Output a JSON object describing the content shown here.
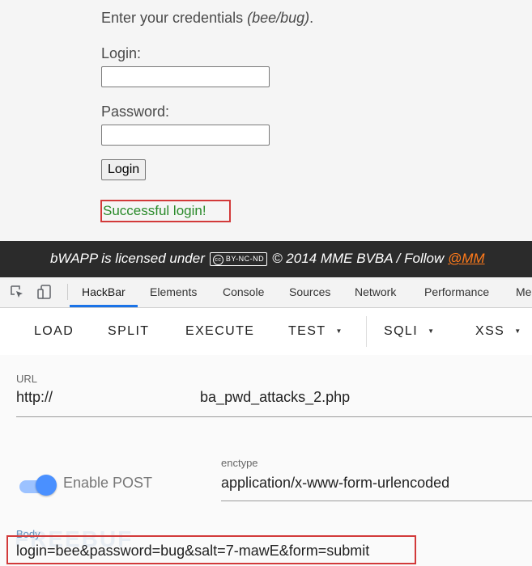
{
  "login_page": {
    "intro_text": "Enter your credentials ",
    "intro_hint": "(bee/bug)",
    "intro_end": ".",
    "login_label": "Login:",
    "password_label": "Password:",
    "login_button": "Login",
    "success_message": "Successful login!"
  },
  "license": {
    "prefix": "bWAPP is licensed under",
    "cc_text": "BY-NC-ND",
    "copyright": "© 2014 MME BVBA / Follow",
    "follow_link": "@MM"
  },
  "devtools": {
    "tabs": [
      "HackBar",
      "Elements",
      "Console",
      "Sources",
      "Network",
      "Performance",
      "Me"
    ],
    "active_tab": "HackBar"
  },
  "hackbar": {
    "buttons": {
      "load": "LOAD",
      "split": "SPLIT",
      "execute": "EXECUTE",
      "test": "TEST",
      "sqli": "SQLI",
      "xss": "XSS"
    },
    "url_label": "URL",
    "url_value": "http://",
    "url_suffix": "ba_pwd_attacks_2.php",
    "enable_post_label": "Enable POST",
    "enable_post_on": true,
    "enctype_label": "enctype",
    "enctype_value": "application/x-www-form-urlencoded",
    "body_label": "Body",
    "body_value": "login=bee&password=bug&salt=7-mawE&form=submit"
  },
  "colors": {
    "accent": "#1a73e8",
    "success": "#2a8a2a",
    "highlight_border": "#d23a3a",
    "follow_link": "#ff7a1a"
  }
}
